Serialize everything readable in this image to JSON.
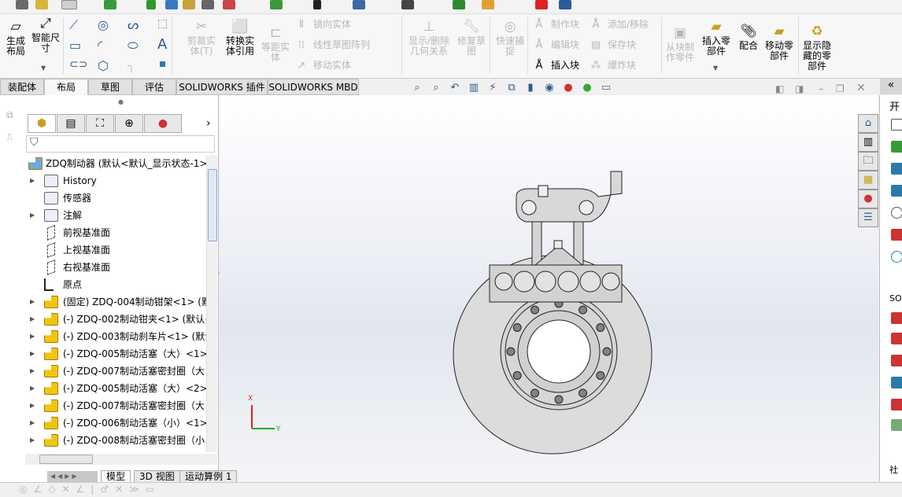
{
  "command_manager": {
    "layout": {
      "label": "生成\n布局"
    },
    "smart_dim": {
      "label": "智能尺\n寸"
    },
    "trim": {
      "label": "剪裁实\n体(T)"
    },
    "convert": {
      "label": "转换实\n体引用"
    },
    "offset": {
      "label": "等距实\n体"
    },
    "mirror": "镜向实体",
    "linear_pattern": "线性草图阵列",
    "move_entities": "移动实体",
    "display_relations": {
      "label": "显示/删除\n几何关系"
    },
    "repair": {
      "label": "修复草\n图"
    },
    "quick_snap": {
      "label": "快速捕\n捉"
    },
    "make_block": "制作块",
    "edit_block": "编辑块",
    "insert_block": "插入块",
    "add_remove": "添加/移除",
    "save_block": "保存块",
    "explode_block": "爆炸块",
    "make_part": {
      "label": "从块制\n作零件"
    },
    "insert_component": {
      "label": "插入零\n部件"
    },
    "mate": {
      "label": "配合"
    },
    "move_component": {
      "label": "移动零\n部件"
    },
    "show_hidden": {
      "label": "显示隐\n藏的零\n部件"
    }
  },
  "tabs": [
    "装配体",
    "布局",
    "草图",
    "评估",
    "SOLIDWORKS 插件",
    "SOLIDWORKS MBD"
  ],
  "active_tab": "布局",
  "tree": {
    "root": "ZDQ制动器 (默认<默认_显示状态-1>)",
    "items": [
      {
        "label": "History",
        "icon": "history-folder-icon",
        "expandable": true
      },
      {
        "label": "传感器",
        "icon": "sensor-folder-icon",
        "expandable": false
      },
      {
        "label": "注解",
        "icon": "annotation-folder-icon",
        "expandable": true
      },
      {
        "label": "前视基准面",
        "icon": "plane-icon",
        "expandable": false
      },
      {
        "label": "上视基准面",
        "icon": "plane-icon",
        "expandable": false
      },
      {
        "label": "右视基准面",
        "icon": "plane-icon",
        "expandable": false
      },
      {
        "label": "原点",
        "icon": "origin-icon",
        "expandable": false
      },
      {
        "label": "(固定) ZDQ-004制动钳架<1> (默",
        "icon": "part-icon",
        "expandable": true
      },
      {
        "label": "(-) ZDQ-002制动钳夹<1> (默认<",
        "icon": "part-icon",
        "expandable": true
      },
      {
        "label": "(-) ZDQ-003制动刹车片<1> (默认",
        "icon": "part-icon",
        "expandable": true
      },
      {
        "label": "(-) ZDQ-005制动活塞（大）<1>",
        "icon": "part-icon",
        "expandable": true
      },
      {
        "label": "(-) ZDQ-007制动活塞密封圈（大",
        "icon": "part-icon",
        "expandable": true
      },
      {
        "label": "(-) ZDQ-005制动活塞（大）<2>",
        "icon": "part-icon",
        "expandable": true
      },
      {
        "label": "(-) ZDQ-007制动活塞密封圈（大",
        "icon": "part-icon",
        "expandable": true
      },
      {
        "label": "(-) ZDQ-006制动活塞（小）<1>",
        "icon": "part-icon",
        "expandable": true
      },
      {
        "label": "(-) ZDQ-008制动活塞密封圈（小",
        "icon": "part-icon",
        "expandable": true
      }
    ]
  },
  "bottom_tabs": [
    "模型",
    "3D 视图",
    "运动算例 1"
  ],
  "active_bottom_tab": "模型",
  "triad": {
    "x": "X",
    "y": "Y"
  },
  "right_pane": {
    "header1": "开",
    "header2": "SO",
    "header3": "社"
  },
  "colors": {
    "viewport_top": "#ffffff",
    "viewport_mid": "#e2e6ee",
    "part_yellow": "#f1c40f",
    "accent_blue": "#2d5a8e"
  }
}
